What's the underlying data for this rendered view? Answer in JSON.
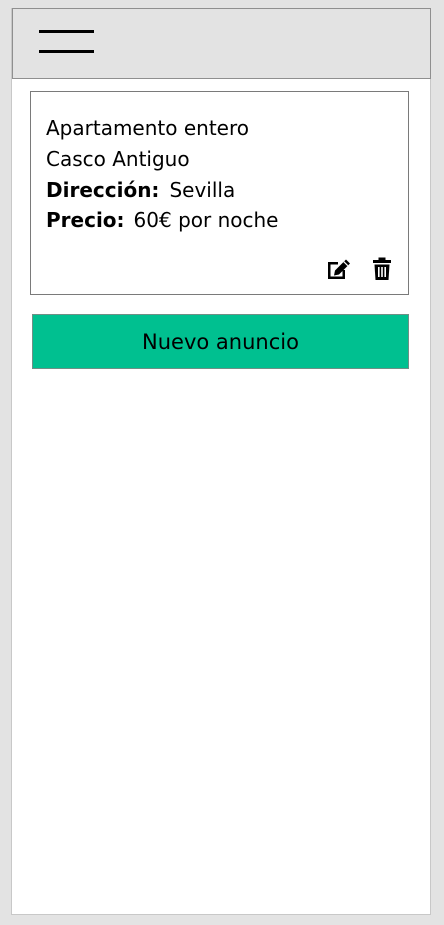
{
  "header": {
    "menu_icon": "hamburger-menu-icon"
  },
  "listing": {
    "type": "Apartamento entero",
    "area": "Casco Antiguo",
    "address_label": "Dirección:",
    "address_value": "Sevilla",
    "price_label": "Precio:",
    "price_value": "60€ por noche",
    "edit_icon": "edit-icon",
    "delete_icon": "trash-icon"
  },
  "actions": {
    "new_listing_label": "Nuevo anuncio"
  },
  "colors": {
    "accent": "#00c090",
    "topbar": "#e3e3e3",
    "background": "#ffffff"
  }
}
